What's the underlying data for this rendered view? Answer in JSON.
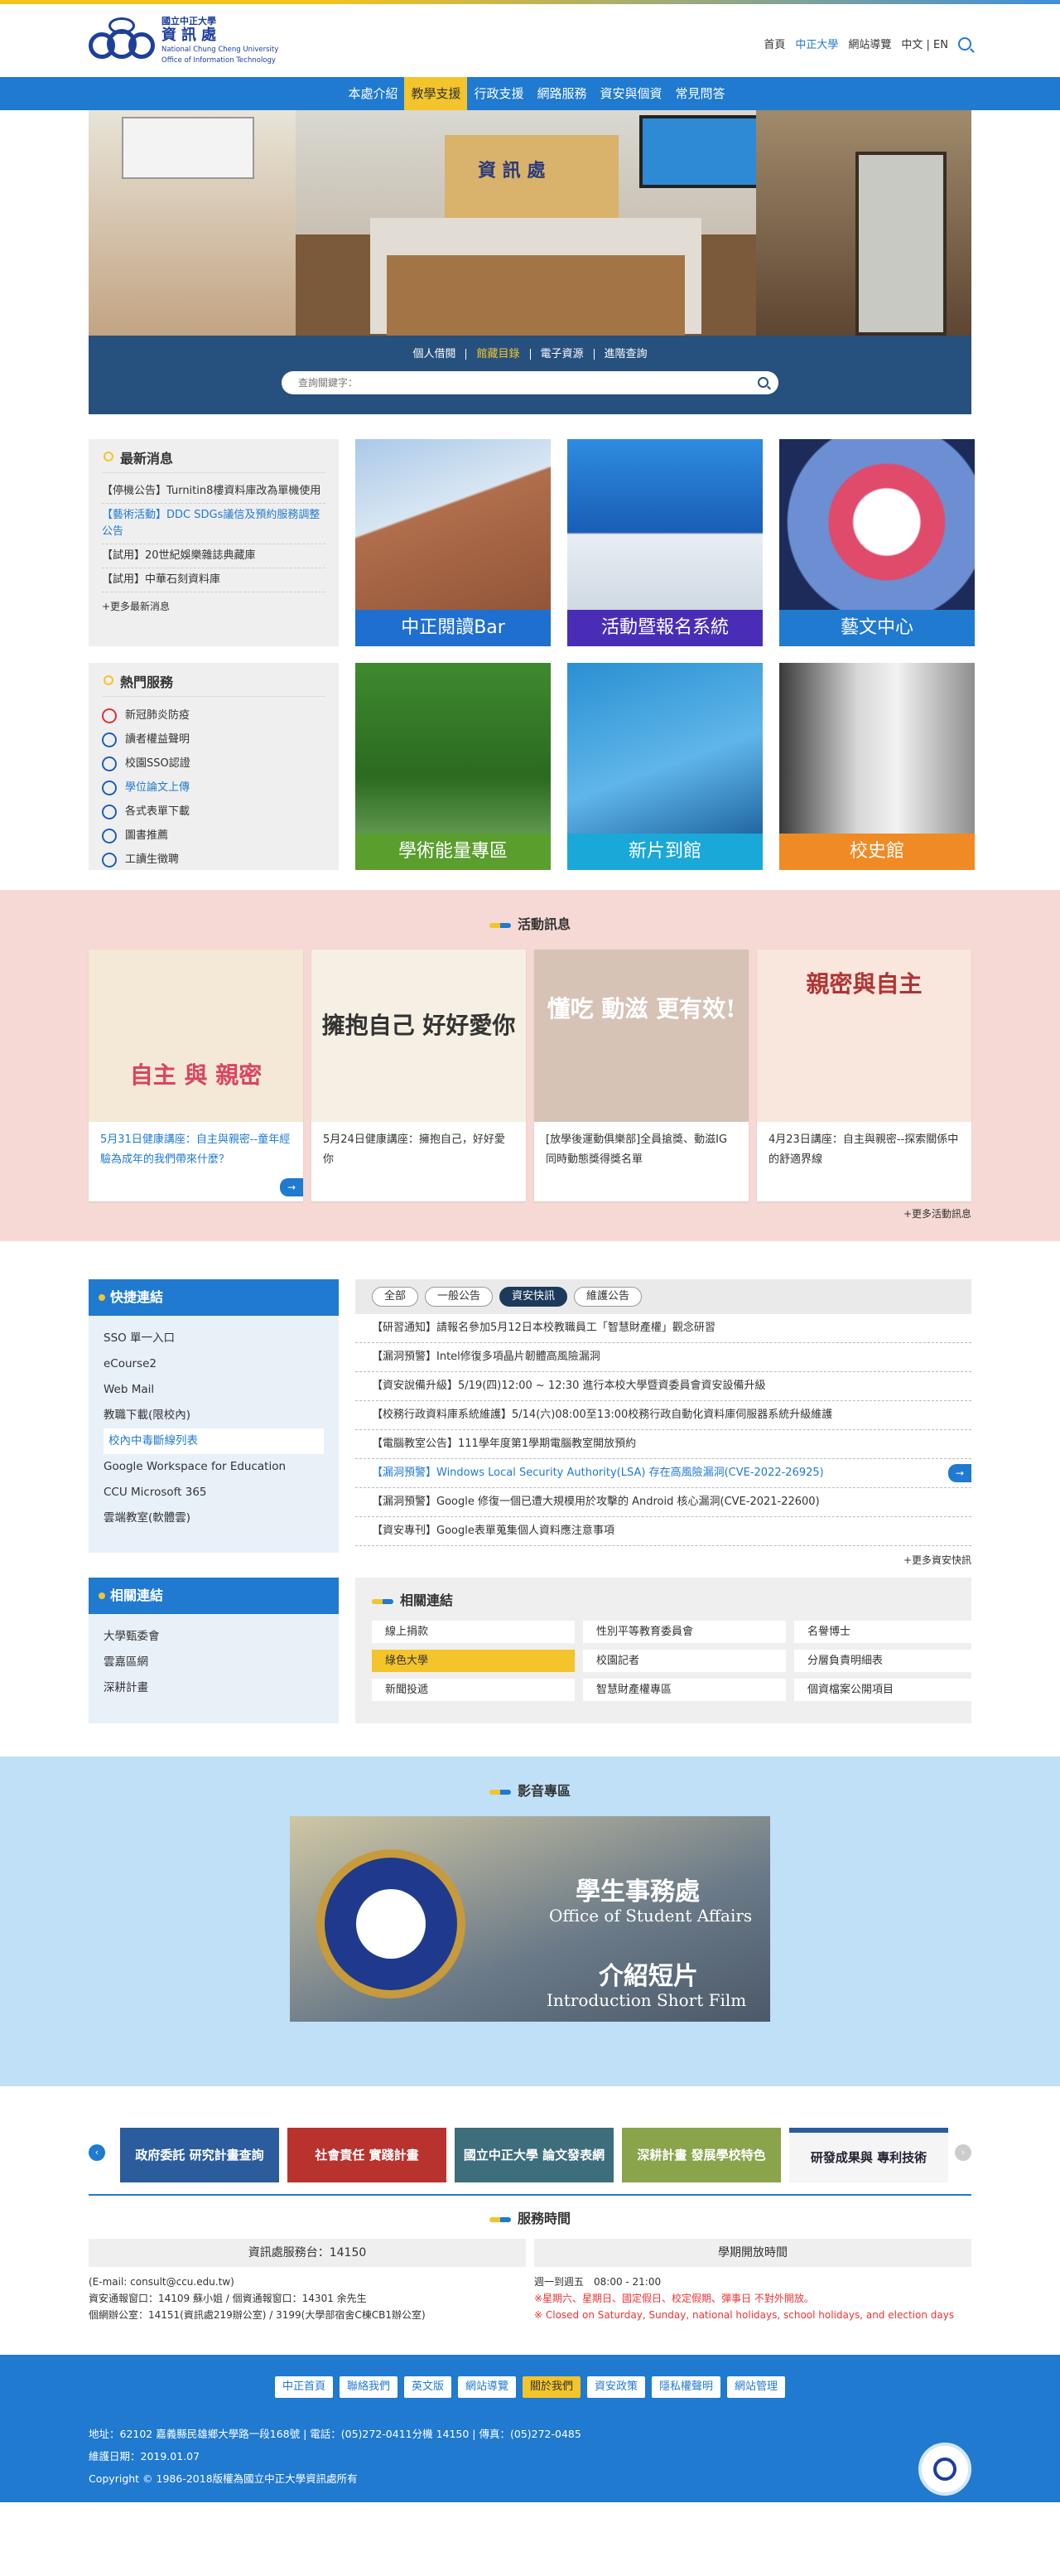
{
  "logo": {
    "line1": "國立中正大學",
    "line2": "資訊處",
    "line3a": "National Chung Cheng University",
    "line3b": "Office of Information Technology"
  },
  "toplinks": [
    "首頁",
    "中正大學",
    "網站導覽",
    "中文",
    "EN"
  ],
  "nav": [
    "本處介紹",
    "教學支援",
    "行政支援",
    "網路服務",
    "資安與個資",
    "常見問答"
  ],
  "hero": {
    "sign": "資 訊 處"
  },
  "library": {
    "links": [
      "個人借閱",
      "館藏目錄",
      "電子資源",
      "進階查詢"
    ],
    "placeholder": "查詢關鍵字："
  },
  "news": {
    "title": "最新消息",
    "items": [
      "【停機公告】Turnitin8樓資料庫改為單機使用",
      "【藝術活動】DDC SDGs議信及預約服務調整公告",
      "【試用】20世紀娛樂雜誌典藏庫",
      "【試用】中華石刻資料庫"
    ],
    "more": "+更多最新消息"
  },
  "hot": {
    "title": "熱門服務",
    "items": [
      "新冠肺炎防疫",
      "讀者權益聲明",
      "校園SSO認證",
      "學位論文上傳",
      "各式表單下載",
      "圖書推薦",
      "工讀生徵聘"
    ]
  },
  "tiles": [
    "中正閱讀Bar",
    "活動暨報名系統",
    "藝文中心",
    "學術能量專區",
    "新片到館",
    "校史館"
  ],
  "events": {
    "title": "活動訊息",
    "cards": [
      {
        "pic": "自主 與 親密",
        "title": "5月31日健康講座：自主與親密--童年經驗為成年的我們帶來什麼？"
      },
      {
        "pic": "擁抱自己 好好愛你",
        "title": "5月24日健康講座：擁抱自己，好好愛你"
      },
      {
        "pic": "懂吃 動滋 更有效!",
        "title": "[放學後運動俱樂部]全員搶獎、動滋IG同時動態獎得獎名單"
      },
      {
        "pic": "親密與自主",
        "title": "4月23日講座：自主與親密--探索關係中的舒適界線"
      }
    ],
    "more": "+更多活動訊息"
  },
  "quick": {
    "title": "快捷連結",
    "items": [
      "SSO 單一入口",
      "eCourse2",
      "Web Mail",
      "教職下載(限校內)",
      "校內中毒斷線列表",
      "Google Workspace for Education",
      "CCU Microsoft 365",
      "雲端教室(軟體雲)"
    ]
  },
  "announce": {
    "tabs": [
      "全部",
      "一般公告",
      "資安快訊",
      "維護公告"
    ],
    "items": [
      "【研習通知】請報名參加5月12日本校教職員工「智慧財產權」觀念研習",
      "【漏洞預警】Intel修復多項晶片韌體高風險漏洞",
      "【資安說備升級】5/19(四)12:00 ~ 12:30 進行本校大學暨資委員會資安設備升級",
      "【校務行政資料庫系統維護】5/14(六)08:00至13:00校務行政自動化資料庫伺服器系統升級維護",
      "【電腦教室公告】111學年度第1學期電腦教室開放預約",
      "【漏洞預警】Windows Local Security Authority(LSA) 存在高風險漏洞(CVE-2022-26925)",
      "【漏洞預警】Google 修復一個已遭大規模用於攻擊的 Android 核心漏洞(CVE-2021-22600)",
      "【資安專刊】Google表單蒐集個人資料應注意事項"
    ],
    "more": "+更多資安快訊"
  },
  "related_side": {
    "title": "相關連結",
    "items": [
      "大學甄委會",
      "雲嘉區網",
      "深耕計畫"
    ]
  },
  "related": {
    "title": "相關連結",
    "items": [
      "線上捐款",
      "性別平等教育委員會",
      "名譽博士",
      "綠色大學",
      "校園記者",
      "分層負責明細表",
      "新聞投遞",
      "智慧財產權專區",
      "個資檔案公開項目"
    ]
  },
  "video": {
    "title": "影音專區",
    "t1": "學生事務處",
    "t2": "Office of Student Affairs",
    "t3": "介紹短片",
    "t4": "Introduction Short Film"
  },
  "banners": [
    "政府委託 研究計畫查詢",
    "社會責任 實踐計畫",
    "國立中正大學 論文發表網",
    "深耕計畫 發展學校特色",
    "研發成果與 專利技術"
  ],
  "hours": {
    "title": "服務時間",
    "left_head": "資訊處服務台：14150",
    "left_lines": [
      "(E-mail: consult@ccu.edu.tw)",
      "資安通報窗口：14109 蘇小姐 / 個資通報窗口：14301 余先生",
      "個網辦公室：14151(資訊處219辦公室) / 3199(大學部宿舍C棟CB1辦公室)"
    ],
    "right_head": "學期開放時間",
    "right_lines": [
      "週一到週五　08:00 - 21:00"
    ],
    "right_red": [
      "※星期六、星期日、國定假日、校定假期、彈事日 不對外開放。",
      "※ Closed on Saturday, Sunday, national holidays, school holidays, and election days"
    ]
  },
  "footer": {
    "buttons": [
      "中正首頁",
      "聯絡我們",
      "英文版",
      "網站導覽",
      "關於我們",
      "資安政策",
      "隱私權聲明",
      "網站管理"
    ],
    "address": "地址：62102 嘉義縣民雄鄉大學路一段168號 | 電話：(05)272-0411分機 14150 | 傳真：(05)272-0485",
    "updated": "維護日期：2019.01.07",
    "copyright": "Copyright © 1986-2018版權為國立中正大學資訊處所有"
  }
}
